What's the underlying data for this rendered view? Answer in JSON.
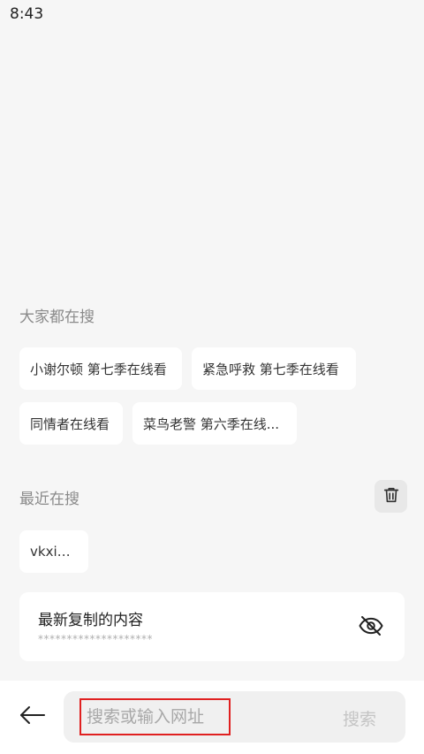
{
  "status_bar": {
    "time": "8:43"
  },
  "hot_searches": {
    "title": "大家都在搜",
    "items": [
      "小谢尔顿 第七季在线看",
      "紧急呼救 第七季在线看",
      "同情者在线看",
      "菜鸟老警  第六季在线..."
    ]
  },
  "recent_searches": {
    "title": "最近在搜",
    "delete_icon": "trash-icon",
    "items": [
      "vkxiazai"
    ]
  },
  "clipboard": {
    "title": "最新复制的内容",
    "masked_content": "********************",
    "toggle_icon": "eye-off-icon"
  },
  "bottom_bar": {
    "back_icon": "arrow-left-icon",
    "search_placeholder": "搜索或输入网址",
    "search_button": "搜索"
  },
  "colors": {
    "background": "#f6f6f6",
    "chip_background": "#ffffff",
    "highlight_border": "#e02020",
    "muted_text": "#8a8a8a"
  }
}
